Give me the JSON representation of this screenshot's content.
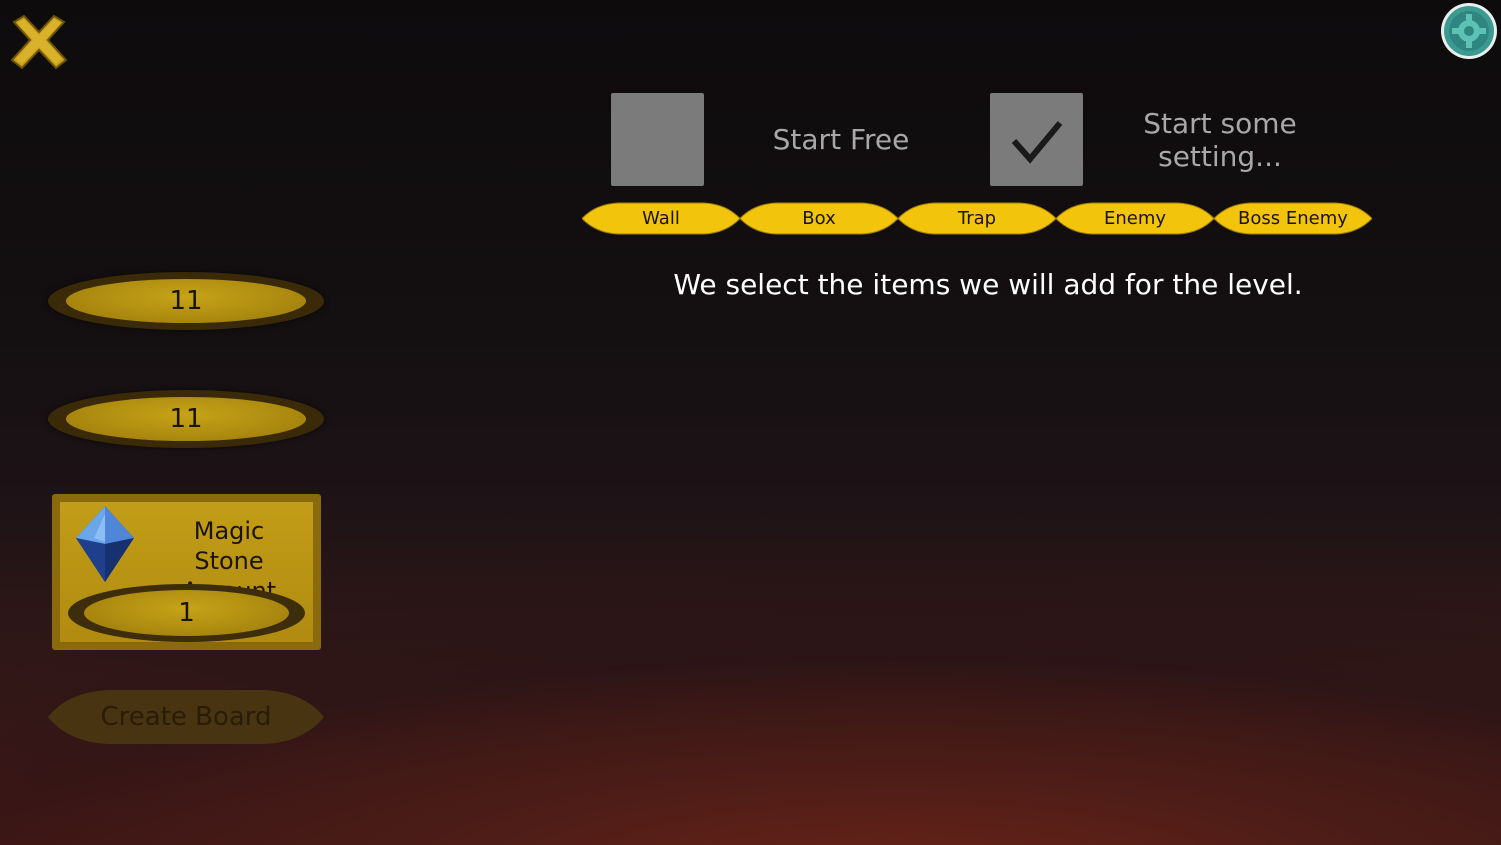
{
  "toolbar": {
    "close_icon": "close-x-icon",
    "settings_icon": "gear-icon"
  },
  "left_panel": {
    "field_1_value": "11",
    "field_2_value": "11",
    "magic_stone": {
      "icon": "blue-gem-icon",
      "label_line1": "Magic Stone",
      "label_line2": "Amount",
      "value": "1"
    },
    "create_board_label": "Create Board"
  },
  "options": {
    "start_free": {
      "label": "Start Free",
      "checked": false
    },
    "start_some": {
      "label_line1": "Start some",
      "label_line2": "setting...",
      "checked": true
    }
  },
  "tabs": [
    {
      "label": "Wall"
    },
    {
      "label": "Box"
    },
    {
      "label": "Trap"
    },
    {
      "label": "Enemy"
    },
    {
      "label": "Boss Enemy"
    }
  ],
  "instruction": "We select the items we will add for the level.",
  "colors": {
    "gold": "#f2c40c",
    "panel_gold": "#b08b10",
    "checkbox_gray": "#7b7b7b"
  }
}
